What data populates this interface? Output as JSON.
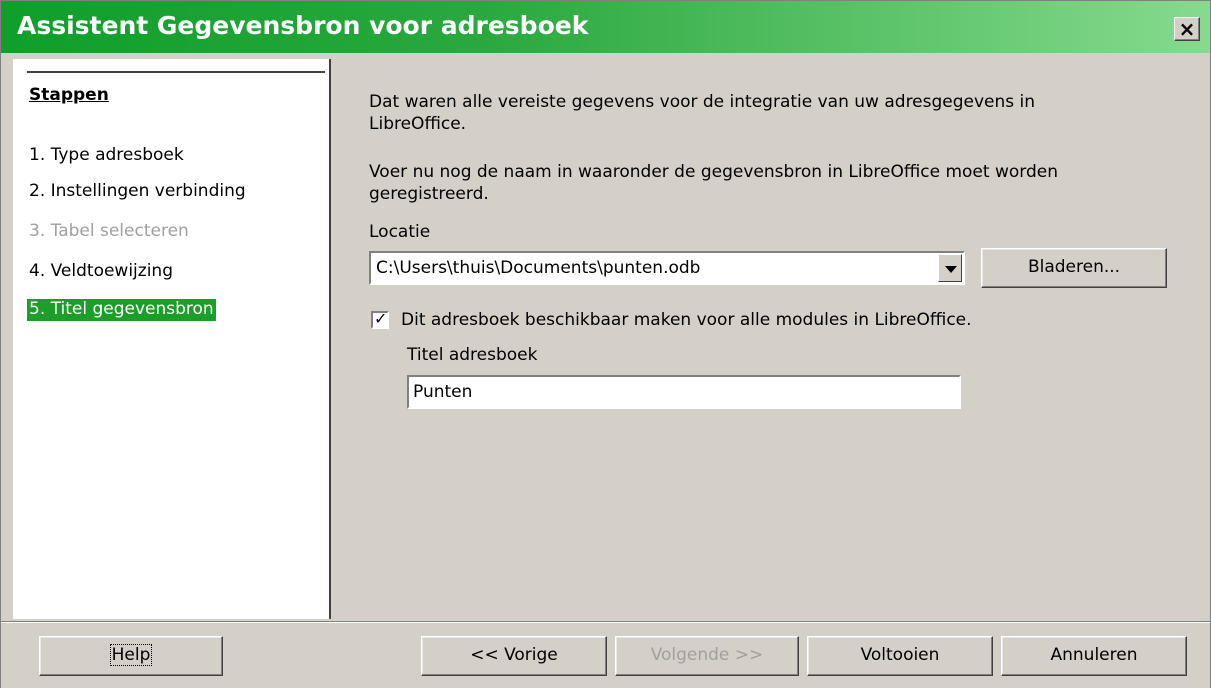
{
  "window": {
    "title": "Assistent Gegevensbron voor adresboek",
    "close_label": "×"
  },
  "steps": {
    "heading": "Stappen",
    "items": [
      {
        "label": "1. Type adresboek"
      },
      {
        "label": "2. Instellingen verbinding"
      },
      {
        "label": "3. Tabel selecteren"
      },
      {
        "label": "4. Veldtoewijzing"
      },
      {
        "label": "5. Titel gegevensbron"
      }
    ]
  },
  "content": {
    "intro": "Dat waren alle vereiste gegevens voor de integratie van uw adresgegevens in LibreOffice.",
    "instruction": "Voer nu nog de naam in waaronder de gegevensbron in LibreOffice moet worden geregistreerd.",
    "location_label": "Locatie",
    "location_value": "C:\\Users\\thuis\\Documents\\punten.odb",
    "browse_label": "Bladeren...",
    "checkbox_label": "Dit adresboek beschikbaar maken voor alle modules in LibreOffice.",
    "checkbox_checked": true,
    "title_label": "Titel adresboek",
    "title_value": "Punten"
  },
  "buttons": {
    "help": "Help",
    "back": "<< Vorige",
    "next": "Volgende >>",
    "finish": "Voltooien",
    "cancel": "Annuleren"
  }
}
